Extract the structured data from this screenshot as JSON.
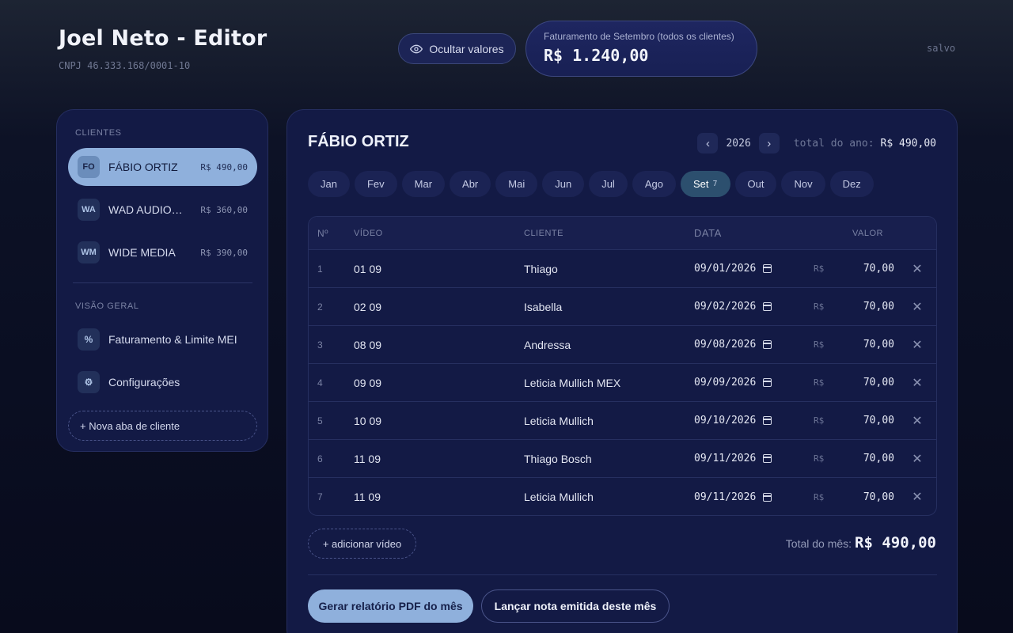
{
  "header": {
    "title": "Joel Neto - Editor",
    "cnpj": "CNPJ 46.333.168/0001-10",
    "hide_values_label": "Ocultar valores",
    "billing_label": "Faturamento de Setembro (todos os clientes)",
    "billing_value": "R$ 1.240,00",
    "saved_status": "salvo"
  },
  "sidebar": {
    "clients_heading": "CLIENTES",
    "clients": [
      {
        "initials": "FO",
        "name": "FÁBIO ORTIZ",
        "amount": "R$ 490,00",
        "active": true
      },
      {
        "initials": "WA",
        "name": "WAD AUDIOVISUAL",
        "amount": "R$ 360,00",
        "active": false
      },
      {
        "initials": "WM",
        "name": "WIDE MEDIA",
        "amount": "R$ 390,00",
        "active": false
      }
    ],
    "overview_heading": "VISÃO GERAL",
    "nav": [
      {
        "icon": "%",
        "icon_name": "percent-icon",
        "label": "Faturamento & Limite MEI"
      },
      {
        "icon": "⚙",
        "icon_name": "gear-icon",
        "label": "Configurações"
      }
    ],
    "new_tab_label": "+ Nova aba de cliente"
  },
  "main": {
    "client_title": "FÁBIO ORTIZ",
    "year": "2026",
    "prev_year": "‹",
    "next_year": "›",
    "year_total_label": "total do ano:",
    "year_total_value": "R$ 490,00",
    "months": [
      {
        "label": "Jan"
      },
      {
        "label": "Fev"
      },
      {
        "label": "Mar"
      },
      {
        "label": "Abr"
      },
      {
        "label": "Mai"
      },
      {
        "label": "Jun"
      },
      {
        "label": "Jul"
      },
      {
        "label": "Ago"
      },
      {
        "label": "Set",
        "active": true,
        "badge": "7"
      },
      {
        "label": "Out"
      },
      {
        "label": "Nov"
      },
      {
        "label": "Dez"
      }
    ],
    "table": {
      "headers": {
        "num": "Nº",
        "video": "VÍDEO",
        "client": "CLIENTE",
        "date": "DATA",
        "value": "VALOR"
      },
      "currency": "R$",
      "rows": [
        {
          "num": "1",
          "video": "01 09",
          "client": "Thiago",
          "date": "09/01/2026",
          "value": "70,00"
        },
        {
          "num": "2",
          "video": "02 09",
          "client": "Isabella",
          "date": "09/02/2026",
          "value": "70,00"
        },
        {
          "num": "3",
          "video": "08 09",
          "client": "Andressa",
          "date": "09/08/2026",
          "value": "70,00"
        },
        {
          "num": "4",
          "video": "09 09",
          "client": "Leticia Mullich MEX",
          "date": "09/09/2026",
          "value": "70,00"
        },
        {
          "num": "5",
          "video": "10 09",
          "client": "Leticia Mullich",
          "date": "09/10/2026",
          "value": "70,00"
        },
        {
          "num": "6",
          "video": "11 09",
          "client": "Thiago Bosch",
          "date": "09/11/2026",
          "value": "70,00"
        },
        {
          "num": "7",
          "video": "11 09",
          "client": "Leticia Mullich",
          "date": "09/11/2026",
          "value": "70,00"
        }
      ]
    },
    "add_video_label": "+ adicionar vídeo",
    "month_total_label": "Total do mês:",
    "month_total_value": "R$ 490,00",
    "pdf_button_label": "Gerar relatório PDF do mês",
    "invoice_button_label": "Lançar nota emitida deste mês"
  }
}
